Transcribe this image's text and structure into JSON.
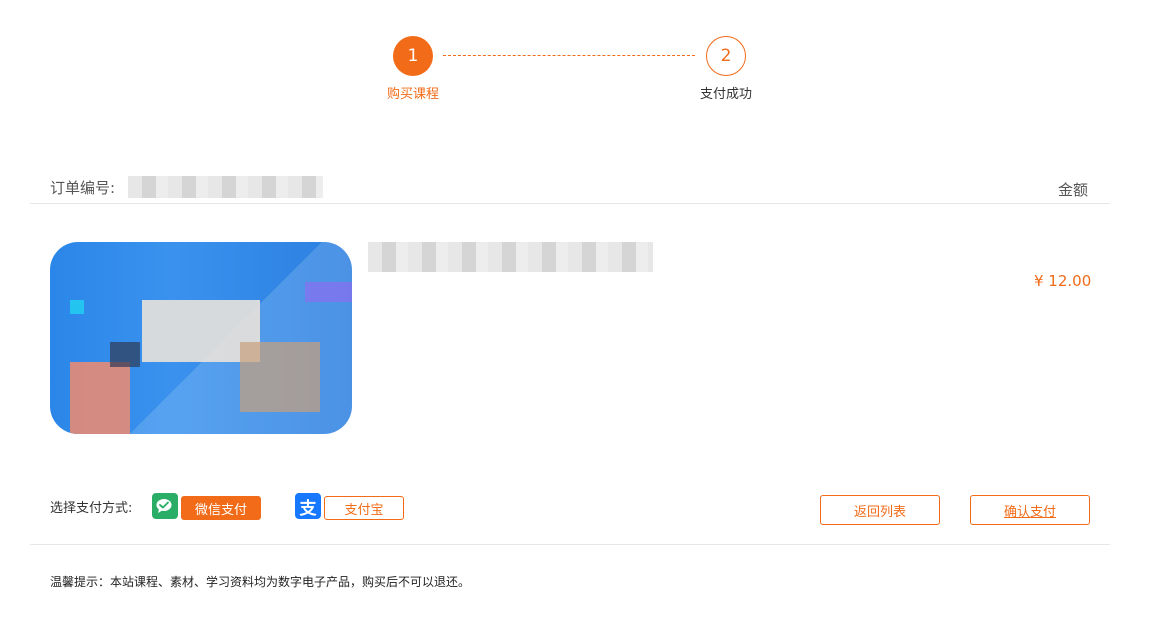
{
  "stepper": {
    "steps": [
      {
        "number": "1",
        "label": "购买课程",
        "state": "active"
      },
      {
        "number": "2",
        "label": "支付成功",
        "state": "todo"
      }
    ]
  },
  "order": {
    "number_label": "订单编号:",
    "amount_label": "金额"
  },
  "product": {
    "price": "¥ 12.00"
  },
  "payment": {
    "label": "选择支付方式:",
    "wechat_label": "微信支付",
    "alipay_label": "支付宝",
    "back_label": "返回列表",
    "confirm_label": "确认支付",
    "selected": "wechat"
  },
  "notice": {
    "text": "温馨提示：本站课程、素材、学习资料均为数字电子产品，购买后不可以退还。"
  },
  "colors": {
    "accent": "#f26b18",
    "wechat": "#2aae67",
    "alipay": "#1678ff"
  },
  "icons": {
    "wechat": "wechat-icon",
    "alipay": "alipay-icon"
  }
}
